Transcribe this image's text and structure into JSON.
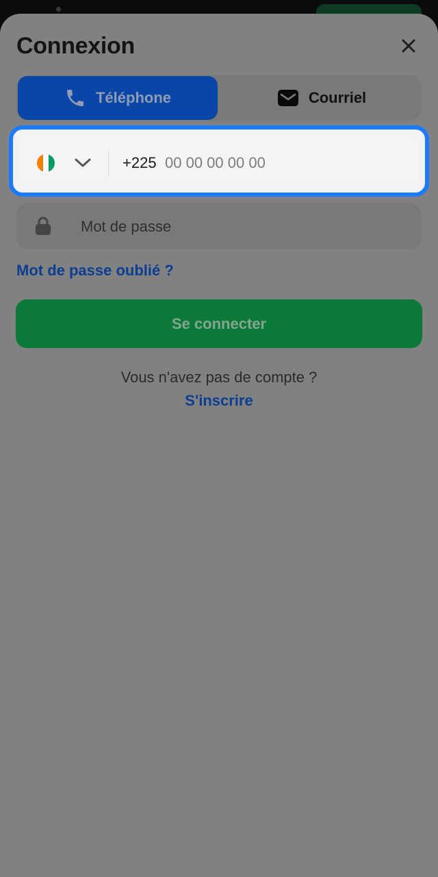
{
  "header": {
    "title": "Connexion"
  },
  "icons": {
    "close": "close-icon",
    "phone_tab": "phone-icon",
    "email_tab": "mail-icon",
    "country_chevron": "chevron-down-icon",
    "password": "lock-icon"
  },
  "tabs": [
    {
      "label": "Téléphone",
      "active": true
    },
    {
      "label": "Courriel",
      "active": false
    }
  ],
  "phone_field": {
    "country_flag": "Côte d'Ivoire",
    "dial_code": "+225",
    "value": "",
    "placeholder": "00 00 00 00 00"
  },
  "password_field": {
    "value": "",
    "placeholder": "Mot de passe"
  },
  "forgot_password_label": "Mot de passe oublié ?",
  "login_button_label": "Se connecter",
  "signup": {
    "prompt": "Vous n'avez pas de compte ?",
    "link_label": "S'inscrire"
  },
  "colors": {
    "accent_blue": "#1a7bff",
    "primary_blue": "#0a46a8",
    "login_green": "#0b7a39",
    "link_blue": "#0b3e91",
    "overlay_gray": "#818181",
    "flag_orange": "#f77f00",
    "flag_white": "#ffffff",
    "flag_green": "#009e60"
  }
}
